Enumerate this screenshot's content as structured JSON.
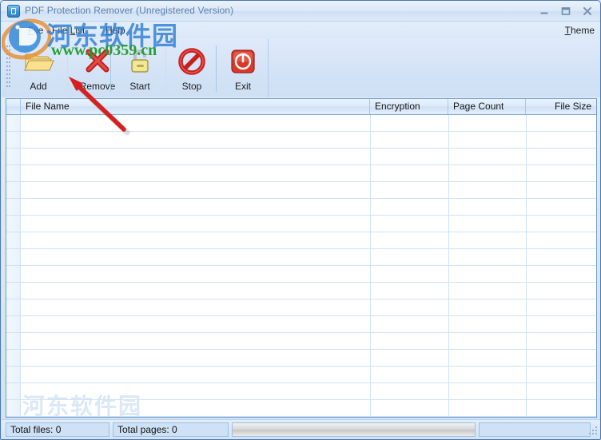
{
  "window": {
    "title": "PDF Protection Remover (Unregistered Version)",
    "app_icon": "pdf-lock-icon",
    "controls": {
      "minimize": "minimize-icon",
      "maximize": "maximize-icon",
      "close": "close-icon"
    },
    "accent_color": "#4b77ad",
    "titlebar_text_color": "#5b7fa8"
  },
  "menubar": {
    "items": [
      {
        "label": "File",
        "accel": "F"
      },
      {
        "label": "File List",
        "accel": "L"
      },
      {
        "label": "Help",
        "accel": "H"
      }
    ],
    "theme_link": {
      "label": "Theme",
      "accel": "T"
    }
  },
  "toolbar": {
    "buttons": [
      {
        "label": "Add",
        "icon": "open-folder-icon"
      },
      {
        "label": "Remove",
        "icon": "red-x-icon"
      },
      {
        "label": "Start",
        "icon": "open-padlock-icon"
      },
      {
        "label": "Stop",
        "icon": "prohibition-sign-icon"
      },
      {
        "label": "Exit",
        "icon": "power-button-icon"
      }
    ]
  },
  "file_list": {
    "columns": [
      {
        "label": "File Name",
        "align": "left"
      },
      {
        "label": "Encryption",
        "align": "left"
      },
      {
        "label": "Page Count",
        "align": "left"
      },
      {
        "label": "File Size",
        "align": "right"
      }
    ],
    "rows": [],
    "empty": true
  },
  "statusbar": {
    "total_files_label": "Total files: 0",
    "total_pages_label": "Total pages: 0",
    "progress_percent": 0,
    "extra_panel": ""
  },
  "watermark": {
    "site_name_cn": "河东软件园",
    "site_url": "www.pc0359.cn",
    "footer_cn": "河东软件园",
    "logo": "pc0359-logo-icon",
    "cn_color": "#2f7fd6",
    "url_color": "#1c9c2e"
  },
  "annotation": {
    "arrow_color": "#d81f1f",
    "arrow_target": "remove-button"
  }
}
